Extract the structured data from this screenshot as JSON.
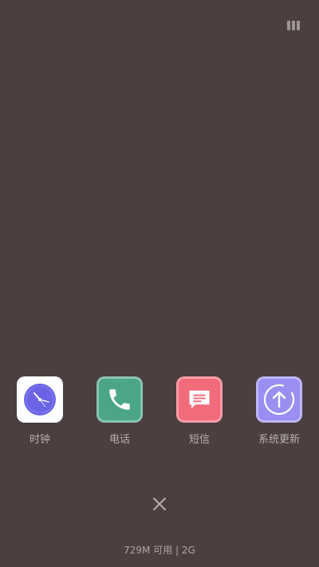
{
  "recents": {
    "apps": [
      {
        "label": "时钟",
        "icon": "clock-icon",
        "color": "#ffffff",
        "accent": "#6b63e6"
      },
      {
        "label": "电话",
        "icon": "phone-icon",
        "color": "#4aa687"
      },
      {
        "label": "短信",
        "icon": "message-icon",
        "color": "#f26b7a"
      },
      {
        "label": "系统更新",
        "icon": "system-update-icon",
        "color": "#9a8ff0"
      }
    ],
    "memory_status": "729M 可用 | 2G"
  },
  "colors": {
    "background": "#4b3f3f",
    "label_text": "#b9b0b0"
  }
}
